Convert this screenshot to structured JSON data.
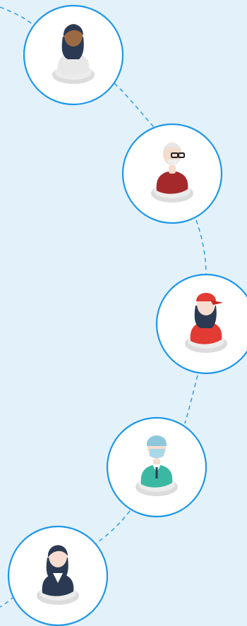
{
  "colors": {
    "background": "#e3f1fa",
    "accent": "#1e97e8",
    "node_fill": "#ffffff"
  },
  "people": [
    {
      "icon": "woman-dark-skin-icon",
      "hair": "#2b3a52",
      "skin": "#9b6a43",
      "clothing": "#e8e8e8"
    },
    {
      "icon": "elderly-man-glasses-icon",
      "hair": "#e6e6e6",
      "skin": "#f3dccb",
      "clothing": "#a5292a"
    },
    {
      "icon": "woman-red-cap-icon",
      "hair": "#2b3a52",
      "skin": "#f6ddd0",
      "clothing": "#e23b33"
    },
    {
      "icon": "doctor-mask-icon",
      "hair": "#8ec7dc",
      "skin": "#f6ddd0",
      "clothing": "#3bb8a2"
    },
    {
      "icon": "businesswoman-icon",
      "hair": "#2b3a52",
      "skin": "#f6ddd0",
      "clothing": "#2b3a52"
    }
  ]
}
